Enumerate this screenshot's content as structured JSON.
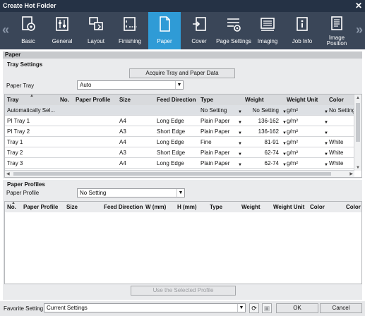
{
  "window": {
    "title": "Create Hot Folder"
  },
  "toolbar": {
    "tabs": [
      {
        "label": "Basic",
        "icon": "basic-icon"
      },
      {
        "label": "General",
        "icon": "general-icon"
      },
      {
        "label": "Layout",
        "icon": "layout-icon"
      },
      {
        "label": "Finishing",
        "icon": "finishing-icon"
      },
      {
        "label": "Paper",
        "icon": "paper-icon"
      },
      {
        "label": "Cover",
        "icon": "cover-icon"
      },
      {
        "label": "Page Settings",
        "icon": "page-settings-icon"
      },
      {
        "label": "Imaging",
        "icon": "imaging-icon"
      },
      {
        "label": "Job Info",
        "icon": "job-info-icon"
      },
      {
        "label": "Image Position",
        "icon": "image-position-icon"
      }
    ],
    "active_tab": "Paper"
  },
  "section_title": "Paper",
  "tray_settings": {
    "title": "Tray Settings",
    "acquire_button": "Acquire Tray and Paper Data",
    "paper_tray_label": "Paper Tray",
    "paper_tray_value": "Auto",
    "table": {
      "columns": [
        "Tray",
        "No.",
        "Paper Profile",
        "Size",
        "Feed Direction",
        "Type",
        "Weight",
        "Weight Unit",
        "Color"
      ],
      "rows": [
        {
          "tray": "Automatically Sel...",
          "no": "",
          "profile": "",
          "size": "",
          "feed": "",
          "type": "No Setting",
          "weight": "No Setting",
          "unit": "g/m²",
          "color": "No Setting"
        },
        {
          "tray": "PI Tray 1",
          "no": "",
          "profile": "",
          "size": "A4",
          "feed": "Long Edge",
          "type": "Plain Paper",
          "weight": "136-162",
          "unit": "g/m²",
          "color": ""
        },
        {
          "tray": "PI Tray 2",
          "no": "",
          "profile": "",
          "size": "A3",
          "feed": "Short Edge",
          "type": "Plain Paper",
          "weight": "136-162",
          "unit": "g/m²",
          "color": ""
        },
        {
          "tray": "Tray 1",
          "no": "",
          "profile": "",
          "size": "A4",
          "feed": "Long Edge",
          "type": "Fine",
          "weight": "81-91",
          "unit": "g/m²",
          "color": "White"
        },
        {
          "tray": "Tray 2",
          "no": "",
          "profile": "",
          "size": "A3",
          "feed": "Short Edge",
          "type": "Plain Paper",
          "weight": "62-74",
          "unit": "g/m²",
          "color": "White"
        },
        {
          "tray": "Tray 3",
          "no": "",
          "profile": "",
          "size": "A4",
          "feed": "Long Edge",
          "type": "Plain Paper",
          "weight": "62-74",
          "unit": "g/m²",
          "color": "White"
        }
      ]
    }
  },
  "paper_profiles": {
    "title": "Paper Profiles",
    "profile_label": "Paper Profile",
    "profile_value": "No Setting",
    "table": {
      "columns": [
        "No.",
        "Paper Profile",
        "Size",
        "Feed Direction",
        "W (mm)",
        "H (mm)",
        "Type",
        "Weight",
        "Weight Unit",
        "Color",
        "Color N"
      ]
    },
    "use_button": "Use the Selected Profile"
  },
  "footer": {
    "favorite_label": "Favorite Setting",
    "favorite_value": "Current Settings",
    "ok_label": "OK",
    "cancel_label": "Cancel"
  },
  "colors": {
    "title_bar": "#253245",
    "toolbar": "#3a4658",
    "active_tab": "#2f9bd6"
  }
}
